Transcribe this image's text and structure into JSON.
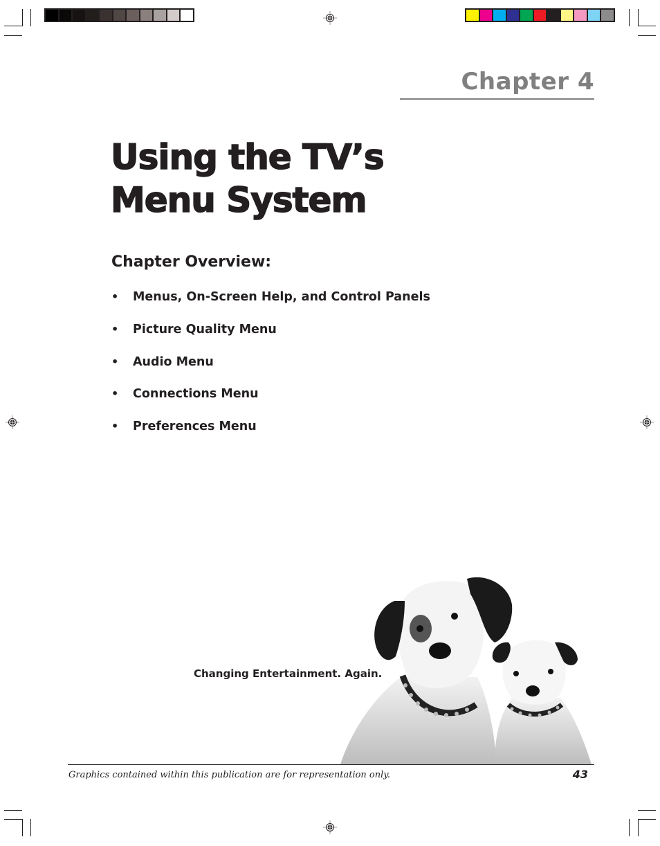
{
  "print_marks": {
    "gray_swatches": [
      "#000000",
      "#0a0908",
      "#161312",
      "#221e1c",
      "#3a3230",
      "#504745",
      "#6a5f5d",
      "#8a807e",
      "#a9a2a0",
      "#d4cccb",
      "#ffffff"
    ],
    "color_swatches": [
      "#fff200",
      "#ec008c",
      "#00aeef",
      "#2e3192",
      "#00a651",
      "#ed1c24",
      "#231f20",
      "#fff685",
      "#f49ac1",
      "#7dd4f5",
      "#8c8c8c"
    ]
  },
  "header": {
    "chapter_label": "Chapter 4"
  },
  "title": {
    "line1": "Using the TV’s",
    "line2": "Menu System"
  },
  "overview": {
    "heading": "Chapter Overview:",
    "bullet": "•",
    "items": [
      "Menus, On-Screen Help, and Control Panels",
      "Picture Quality Menu",
      "Audio Menu",
      "Connections Menu",
      "Preferences Menu"
    ]
  },
  "branding": {
    "tagline": "Changing Entertainment. Again.",
    "image_subject": "two-dogs-photo"
  },
  "footer": {
    "note": "Graphics contained within this publication are for representation only.",
    "page_number": "43"
  }
}
